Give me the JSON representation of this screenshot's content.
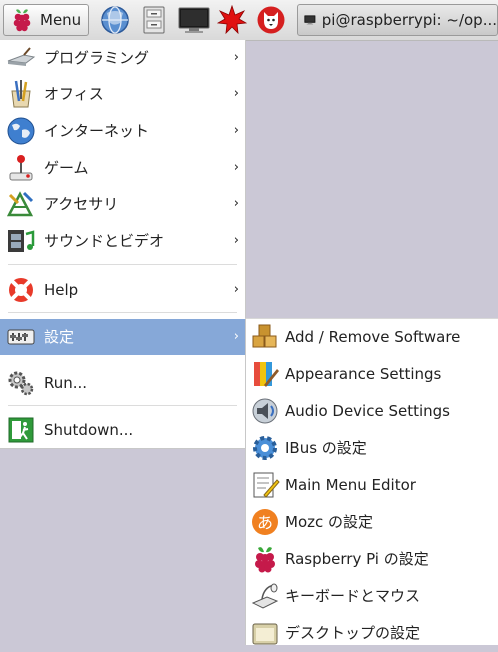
{
  "taskbar": {
    "menu_label": "Menu",
    "window_title": "pi@raspberrypi: ~/op..."
  },
  "main_menu": {
    "items": [
      {
        "label": "プログラミング",
        "icon": "programming-icon"
      },
      {
        "label": "オフィス",
        "icon": "office-icon"
      },
      {
        "label": "インターネット",
        "icon": "internet-globe-icon"
      },
      {
        "label": "ゲーム",
        "icon": "joystick-icon"
      },
      {
        "label": "アクセサリ",
        "icon": "accessories-icon"
      },
      {
        "label": "サウンドとビデオ",
        "icon": "film-music-icon"
      },
      {
        "label": "Help",
        "icon": "lifebuoy-icon"
      },
      {
        "label": "設定",
        "icon": "preferences-icon"
      },
      {
        "label": "Run...",
        "icon": "run-gear-icon"
      },
      {
        "label": "Shutdown...",
        "icon": "exit-icon"
      }
    ],
    "submenu_arrow": "›"
  },
  "settings_submenu": {
    "items": [
      {
        "label": "Add / Remove Software",
        "icon": "packages-icon"
      },
      {
        "label": "Appearance Settings",
        "icon": "palette-icon"
      },
      {
        "label": "Audio Device Settings",
        "icon": "speaker-icon"
      },
      {
        "label": "IBus の設定",
        "icon": "gear-icon"
      },
      {
        "label": "Main Menu Editor",
        "icon": "menu-editor-icon"
      },
      {
        "label": "Mozc の設定",
        "icon": "mozc-icon"
      },
      {
        "label": "Raspberry Pi の設定",
        "icon": "raspberry-icon"
      },
      {
        "label": "キーボードとマウス",
        "icon": "keyboard-mouse-icon"
      },
      {
        "label": "デスクトップの設定",
        "icon": "desktop-icon"
      }
    ]
  }
}
